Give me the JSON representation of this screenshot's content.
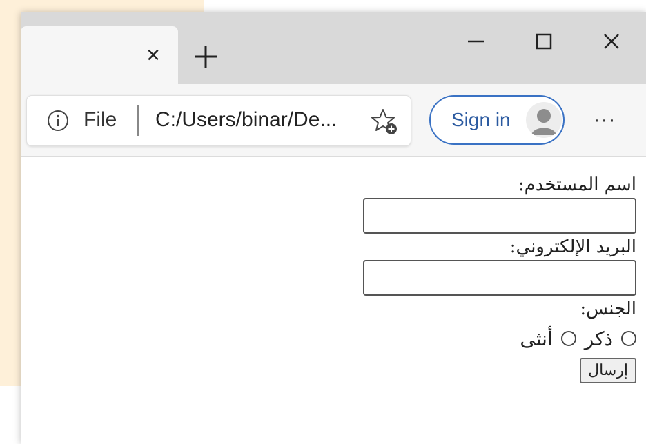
{
  "browser": {
    "tab": {
      "close_glyph": "×"
    },
    "new_tab_icon": "plus-icon",
    "window_controls": [
      "minimize-icon",
      "maximize-icon",
      "close-icon"
    ],
    "address_bar": {
      "info_icon": "info-icon",
      "scheme_label": "File",
      "url": "C:/Users/binar/De...",
      "favorite_icon": "add-favorite-icon"
    },
    "sign_in_label": "Sign in",
    "more_label": "···",
    "accent_color": "#3a72c4"
  },
  "form": {
    "username_label": "اسم المستخدم:",
    "email_label": "البريد الإلكتروني:",
    "gender_label": "الجنس:",
    "gender_options": [
      "ذكر",
      "أنثى"
    ],
    "submit_label": "إرسال"
  }
}
